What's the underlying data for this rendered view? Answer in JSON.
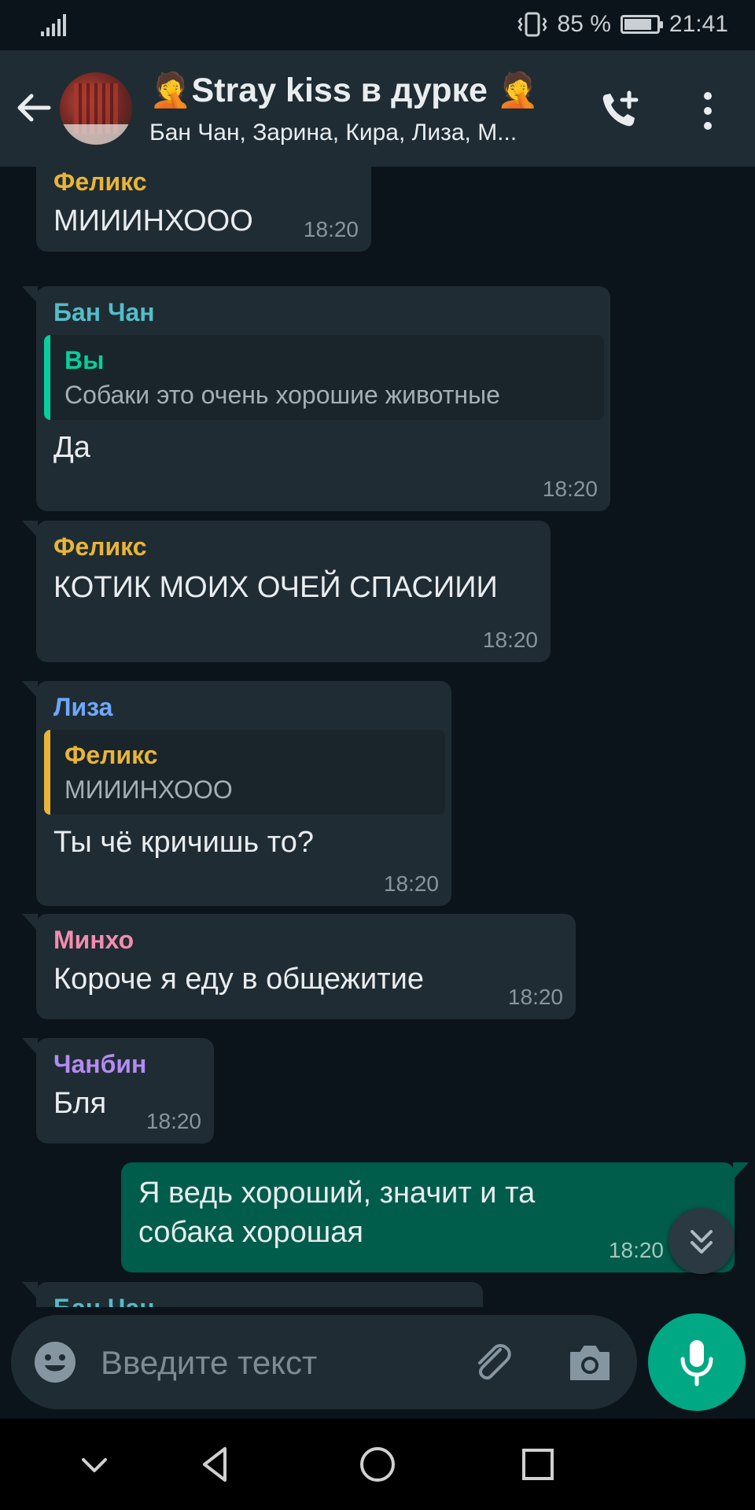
{
  "status_bar": {
    "battery": "85 %",
    "time": "21:41",
    "battery_level": 0.85
  },
  "header": {
    "title": "🤦Stray kiss в дурке 🤦",
    "subtitle": "Бан Чан, Зарина, Кира, Лиза, М..."
  },
  "messages": [
    {
      "sender": "Феликс",
      "sender_color": "#e8b53a",
      "text": "МИИИНХООО",
      "time": "18:20"
    },
    {
      "sender": "Бан Чан",
      "sender_color": "#53bdc9",
      "quote": {
        "name": "Вы",
        "name_color": "#06cf9c",
        "text": "Собаки это очень хорошие животные"
      },
      "text": "Да",
      "time": "18:20"
    },
    {
      "sender": "Феликс",
      "sender_color": "#e8b53a",
      "text": "КОТИК МОИХ ОЧЕЙ СПАСИИИ",
      "time": "18:20"
    },
    {
      "sender": "Лиза",
      "sender_color": "#6ea8ff",
      "quote": {
        "name": "Феликс",
        "name_color": "#e8b53a",
        "text": "МИИИНХООО"
      },
      "text": "Ты чё кричишь то?",
      "time": "18:20"
    },
    {
      "sender": "Минхо",
      "sender_color": "#f28cb1",
      "text": "Короче я еду в общежитие",
      "time": "18:20"
    },
    {
      "sender": "Чанбин",
      "sender_color": "#b28cf2",
      "text": "Бля",
      "time": "18:20"
    },
    {
      "outgoing": true,
      "text_line1": "Я ведь хороший, значит и та",
      "text_line2": "собака хорошая",
      "time": "18:20"
    },
    {
      "sender": "Бан Чан",
      "sender_color": "#53bdc9",
      "partial": true
    }
  ],
  "input": {
    "placeholder": "Введите текст",
    "value": ""
  },
  "colors": {
    "accent": "#00a884",
    "outgoing_bubble": "#005c4b",
    "incoming_bubble": "#202c33",
    "header": "#1f2c34"
  }
}
